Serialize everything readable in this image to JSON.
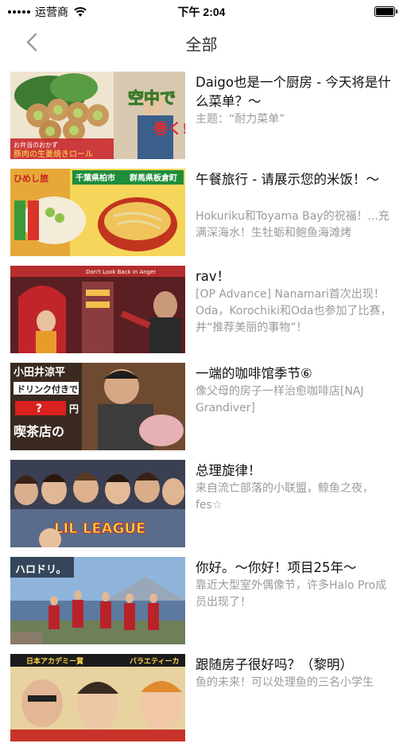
{
  "status_bar": {
    "carrier": "运营商",
    "time": "下午 2:04"
  },
  "nav": {
    "title": "全部"
  },
  "items": [
    {
      "title": "Daigo也是一个厨房 - 今天将是什么菜单？～",
      "subtitle": "主题：“耐力菜单”"
    },
    {
      "title": "午餐旅行 - 请展示您的米饭！～",
      "subtitle": "Hokuriku和Toyama Bay的祝福！...充满深海水！生牡蛎和鲍鱼海滩烤"
    },
    {
      "title": "rav！",
      "subtitle": "[OP Advance] Nanamari首次出现！Oda，Korochiki和Oda也参加了比赛，并“推荐美丽的事物”！"
    },
    {
      "title": "一端的咖啡馆季节⑥",
      "subtitle": "像父母的房子一样治愈咖啡店[NAJ Grandiver]"
    },
    {
      "title": "总理旋律！",
      "subtitle": "来自流亡部落的小联盟，鲸鱼之夜，fes☆"
    },
    {
      "title": "你好。～你好！项目25年～",
      "subtitle": "靠近大型室外偶像节，许多Halo Pro成员出现了！"
    },
    {
      "title": "跟随房子很好吗？（黎明）",
      "subtitle": "鱼的未来！可以处理鱼的三名小学生"
    }
  ],
  "thumb_texts": {
    "t1": [
      "空中で",
      "巻く!",
      "お弁当のおかず",
      "豚肉の生姜焼きロール"
    ],
    "t2": [
      "ひめし旅",
      "千葉県柏市",
      "群馬県板倉町"
    ],
    "t3": [
      "Don't Look Back in Anger"
    ],
    "t4": [
      "小田井涼平",
      "ドリンク付きで",
      "?",
      "円",
      "喫茶店の"
    ],
    "t5": [
      "LIL LEAGUE"
    ],
    "t6": [
      "ハロドリ。"
    ],
    "t7": [
      "日本アカデミー賞",
      "バラエティーカ"
    ]
  }
}
